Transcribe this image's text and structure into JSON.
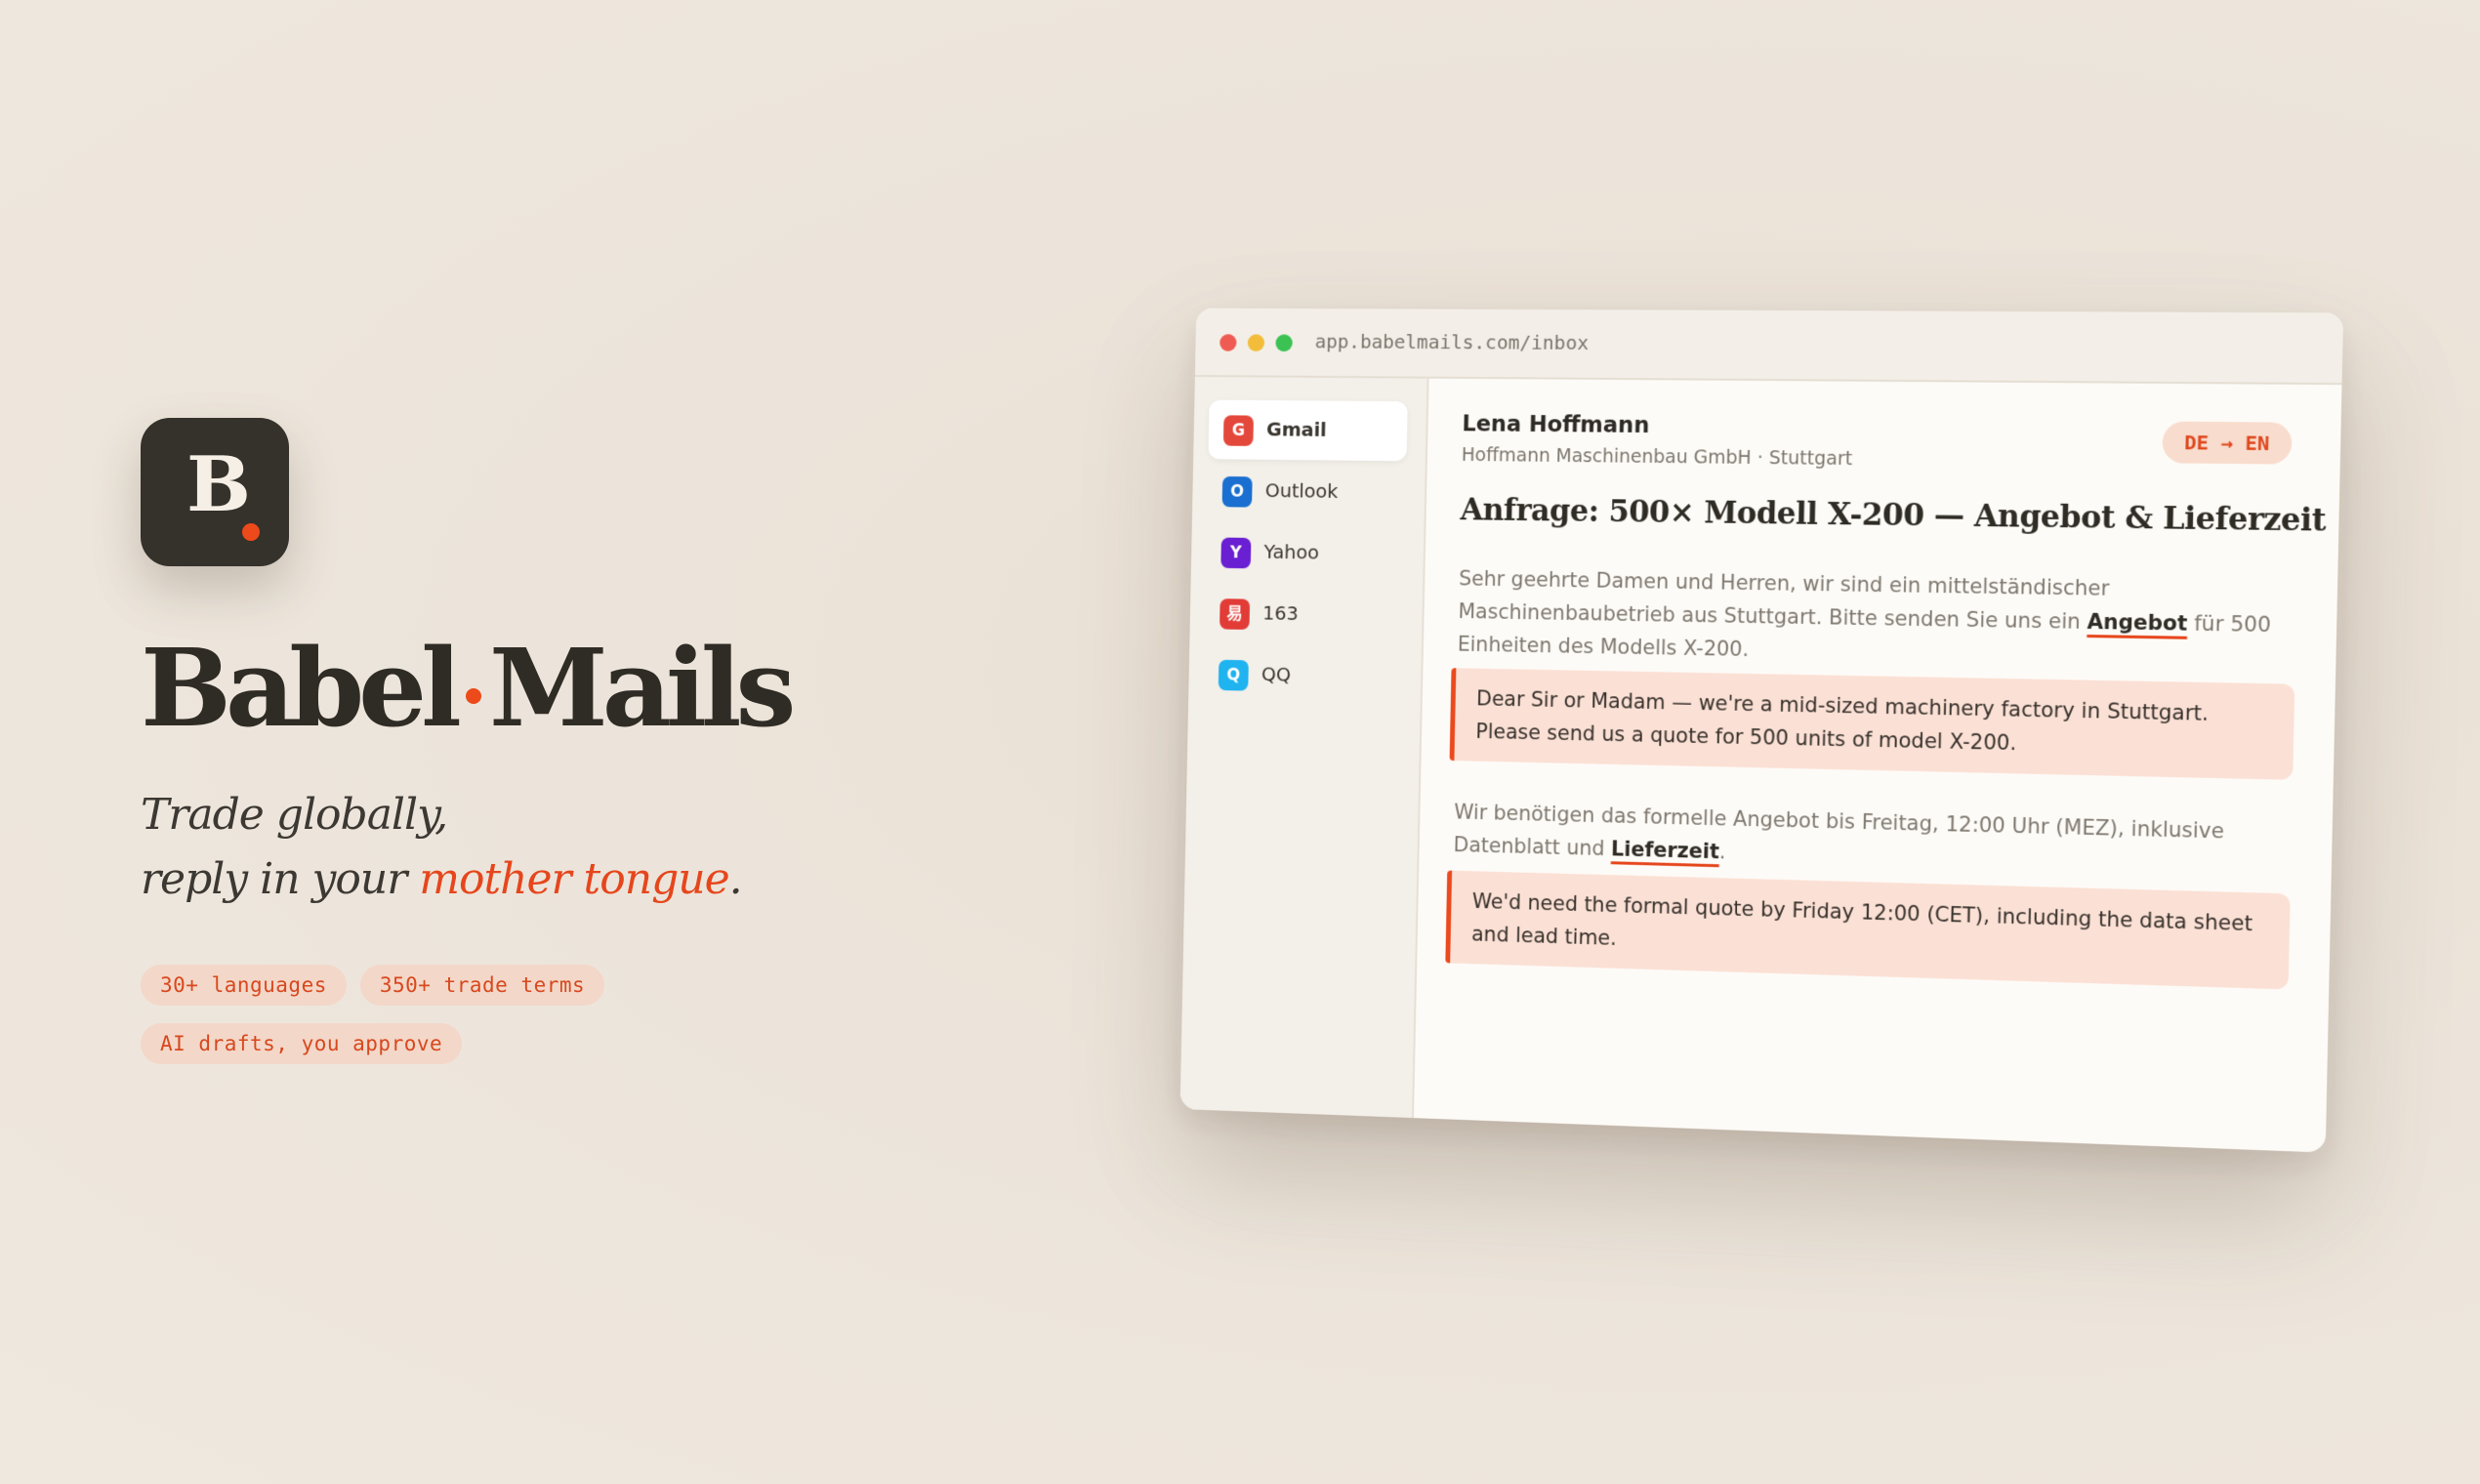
{
  "hero": {
    "icon_letter": "B",
    "brand_left": "Babel",
    "brand_right": "Mails",
    "tagline_line1": "Trade globally,",
    "tagline_line2_prefix": "reply in your ",
    "tagline_highlight": "mother tongue",
    "tagline_suffix": ".",
    "pills": [
      "30+ languages",
      "350+ trade terms",
      "AI drafts, you approve"
    ]
  },
  "colors": {
    "accent": "#ec4a1a",
    "background": "#ece4da",
    "icon_bg": "#35312b"
  },
  "browser": {
    "url": "app.babelmails.com/inbox"
  },
  "accounts": [
    {
      "badge": "G",
      "name": "Gmail",
      "color": "#e4483b",
      "active": true
    },
    {
      "badge": "O",
      "name": "Outlook",
      "color": "#1a6fd1",
      "active": false
    },
    {
      "badge": "Y",
      "name": "Yahoo",
      "color": "#6a1fd2",
      "active": false
    },
    {
      "badge": "易",
      "name": "163",
      "color": "#e23c37",
      "active": false
    },
    {
      "badge": "Q",
      "name": "QQ",
      "color": "#1fb3f0",
      "active": false
    }
  ],
  "email": {
    "sender": "Lena Hoffmann",
    "company": "Hoffmann Maschinenbau GmbH · Stuttgart",
    "lang_badge": "DE → EN",
    "subject": "Anfrage: 500× Modell X-200 — Angebot & Lieferzeit",
    "para1_before": "Sehr geehrte Damen und Herren, wir sind ein mittelständischer Maschinenbaubetrieb aus Stuttgart. Bitte senden Sie uns ein ",
    "para1_term": "Angebot",
    "para1_after": " für 500 Einheiten des Modells X-200.",
    "translation1": "Dear Sir or Madam — we're a mid-sized machinery factory in Stuttgart. Please send us a quote for 500 units of model X-200.",
    "para2_before": "Wir benötigen das formelle Angebot bis Freitag, 12:00 Uhr (MEZ), inklusive Datenblatt und ",
    "para2_term": "Lieferzeit",
    "para2_after": ".",
    "translation2": "We'd need the formal quote by Friday 12:00 (CET), including the data sheet and lead time."
  }
}
